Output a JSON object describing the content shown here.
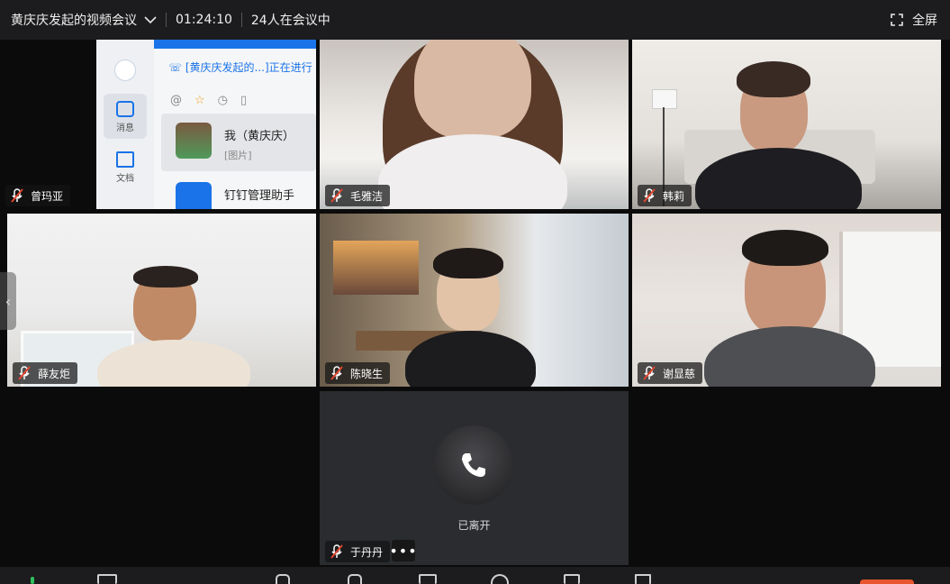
{
  "topbar": {
    "meeting_title": "黄庆庆发起的视频会议",
    "duration": "01:24:10",
    "participants": "24人在会议中",
    "fullscreen_label": "全屏"
  },
  "shared_screen": {
    "notice": "[黄庆庆发起的...]正在进行",
    "rail_items": [
      {
        "label": "消息",
        "icon": "message-icon"
      },
      {
        "label": "文档",
        "icon": "document-icon"
      }
    ],
    "chats": [
      {
        "name": "我（黄庆庆）",
        "preview": "[图片]"
      },
      {
        "name": "钉钉管理助手",
        "preview": ""
      }
    ]
  },
  "participants": [
    {
      "name": "曾玛亚",
      "muted": true
    },
    {
      "name": "毛雅洁",
      "muted": true
    },
    {
      "name": "韩莉",
      "muted": true
    },
    {
      "name": "薛友炬",
      "muted": true
    },
    {
      "name": "陈晓生",
      "muted": true
    },
    {
      "name": "谢显慈",
      "muted": true
    },
    {
      "name": "于丹丹",
      "muted": true,
      "status": "已离开"
    }
  ],
  "more_label": "•••",
  "colors": {
    "topbar": "#1c1c1e",
    "accent": "#1a73e8",
    "mute_red": "#e0452f",
    "stage": "#0b0b0c"
  }
}
